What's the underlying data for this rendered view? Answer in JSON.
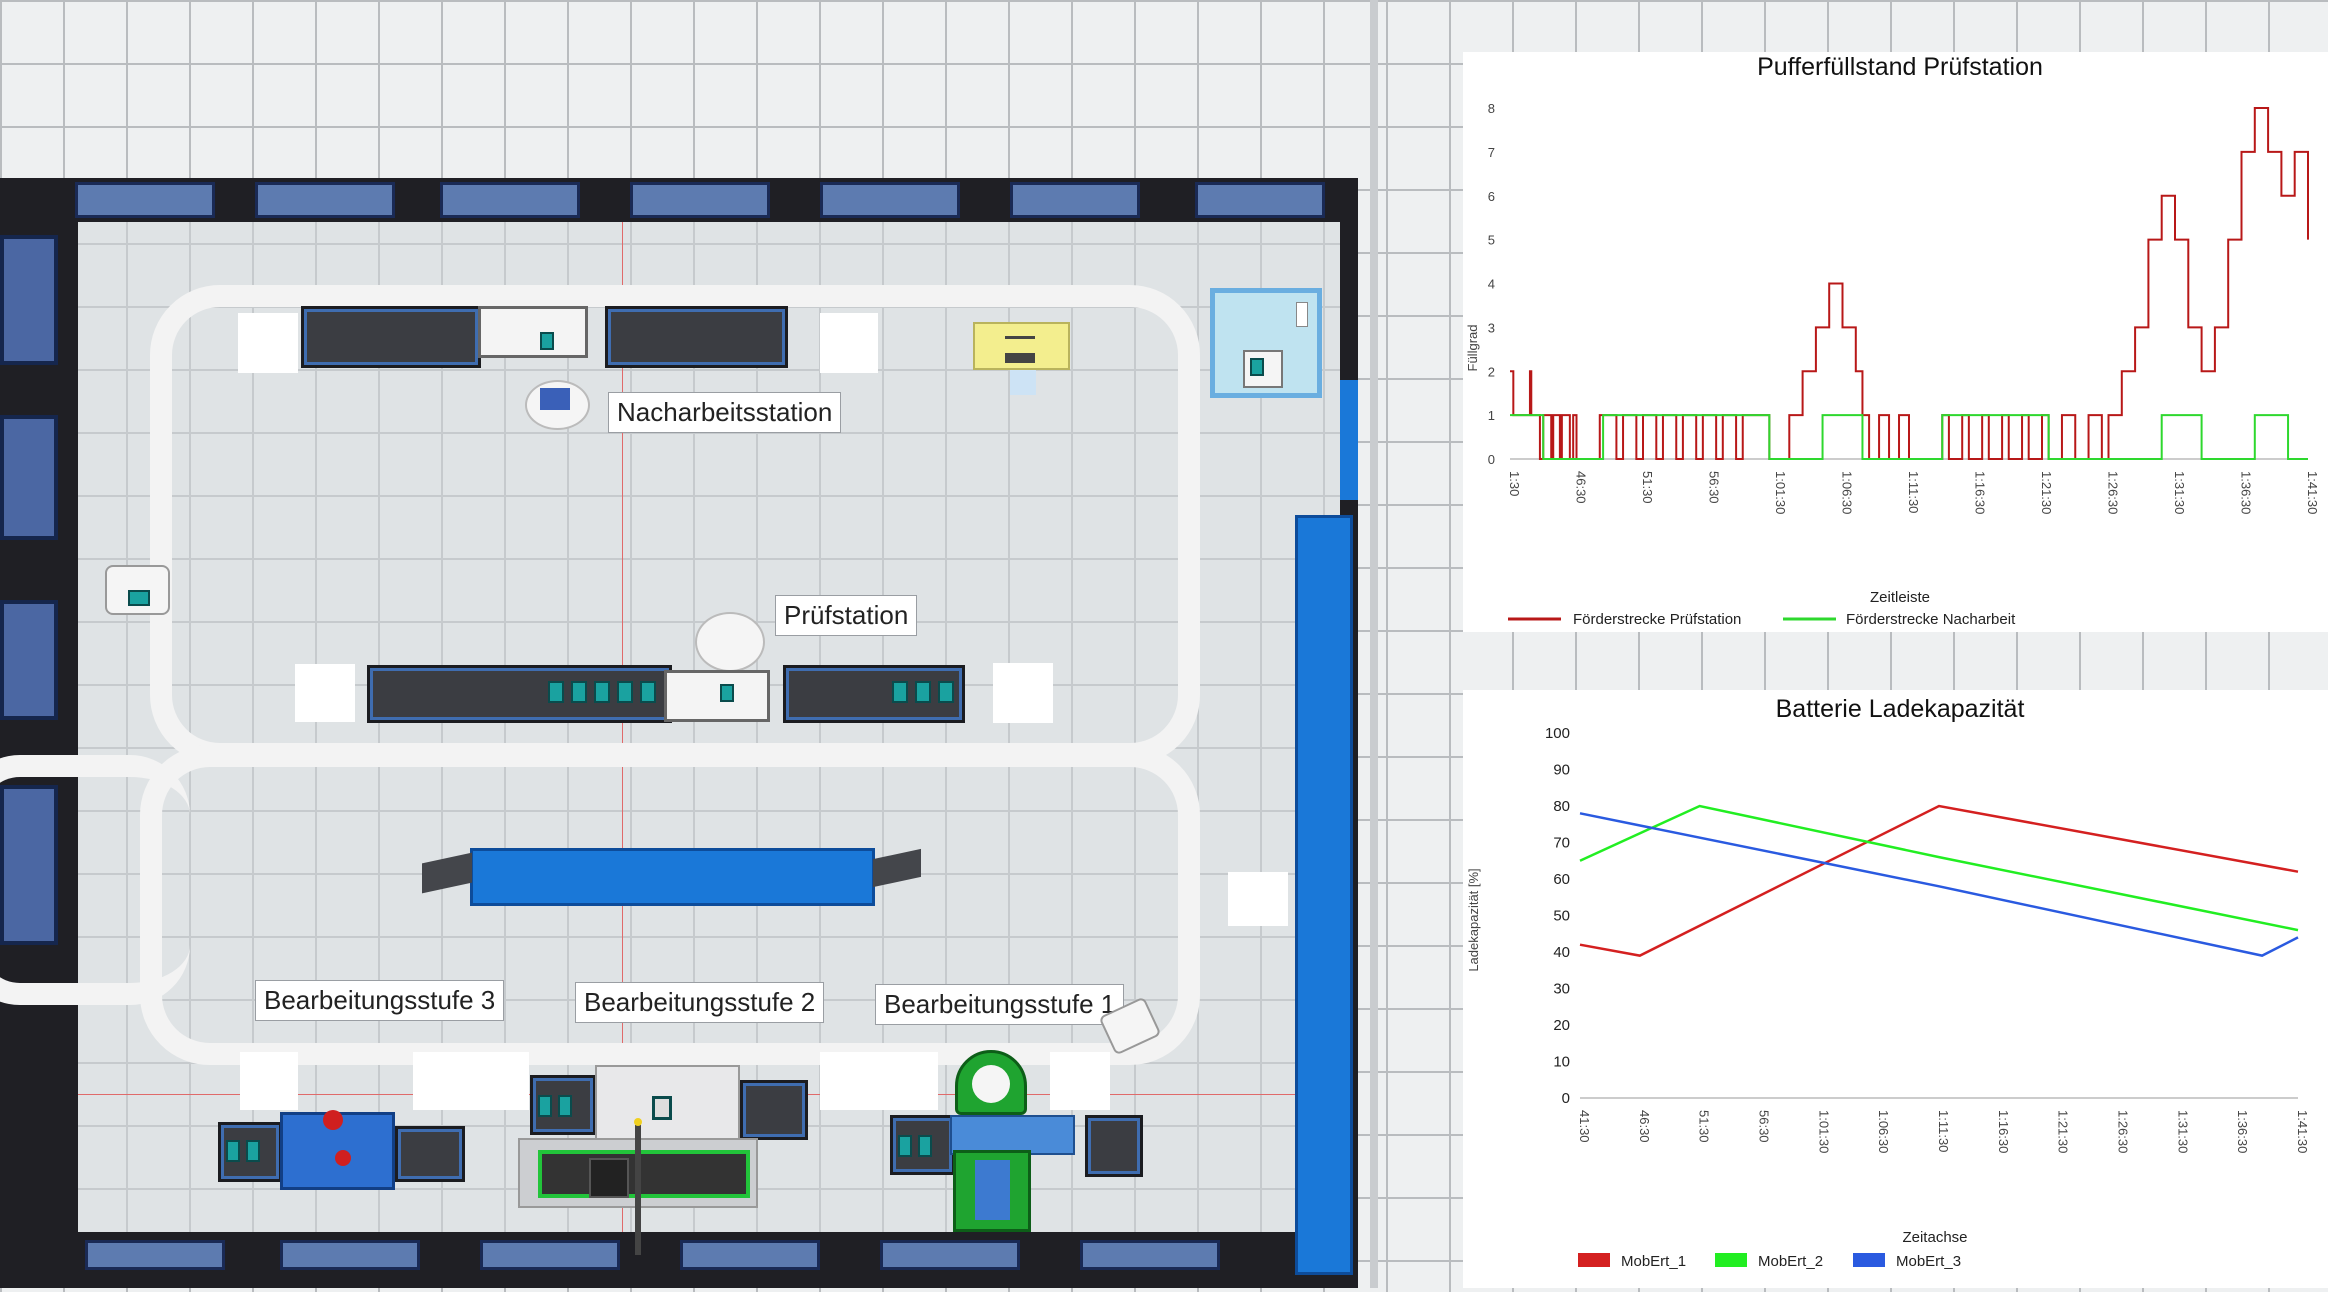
{
  "scene": {
    "stations": {
      "rework": "Nacharbeitsstation",
      "inspection": "Prüfstation",
      "stage3": "Bearbeitungsstufe 3",
      "stage2": "Bearbeitungsstufe 2",
      "stage1": "Bearbeitungsstufe 1"
    }
  },
  "colors": {
    "wall": "#1f1f24",
    "conveyor_blue": "#1a78d8",
    "teal": "#1aa2a0",
    "series_red": "#d42020",
    "series_green": "#22ee22",
    "series_blue": "#2a5ae0",
    "buffer_red": "#b81818",
    "buffer_green": "#2ed82e"
  },
  "charts": {
    "buffer": {
      "title": "Pufferfüllstand Prüfstation",
      "ylabel": "Füllgrad",
      "xlabel": "Zeitleiste",
      "legend": [
        "Förderstrecke Prüfstation",
        "Förderstrecke Nacharbeit"
      ]
    },
    "battery": {
      "title": "Batterie Ladekapazität",
      "ylabel": "Ladekapazität [%]",
      "xlabel": "Zeitachse",
      "legend": [
        "MobErt_1",
        "MobErt_2",
        "MobErt_3"
      ]
    }
  },
  "chart_data": [
    {
      "type": "line",
      "title": "Pufferfüllstand Prüfstation",
      "xlabel": "Zeitleiste",
      "ylabel": "Füllgrad",
      "ylim": [
        0,
        8
      ],
      "yticks": [
        0,
        1,
        2,
        3,
        4,
        5,
        6,
        7,
        8
      ],
      "xtick_labels": [
        "1:30",
        "46:30",
        "51:30",
        "56:30",
        "1:01:30",
        "1:06:30",
        "1:11:30",
        "1:16:30",
        "1:21:30",
        "1:26:30",
        "1:31:30",
        "1:36:30",
        "1:41:30"
      ],
      "xlim": [
        0,
        12
      ],
      "grid": false,
      "legend_position": "bottom",
      "series": [
        {
          "name": "Förderstrecke Prüfstation",
          "x": [
            0,
            0.05,
            0.3,
            0.32,
            0.45,
            0.5,
            0.62,
            0.65,
            0.75,
            0.78,
            0.9,
            0.95,
            1.0,
            1.05,
            1.3,
            1.35,
            1.6,
            1.7,
            1.9,
            2.0,
            2.2,
            2.3,
            2.5,
            2.6,
            2.8,
            2.9,
            3.1,
            3.2,
            3.4,
            3.5,
            3.9,
            4.2,
            4.4,
            4.6,
            4.8,
            5.0,
            5.2,
            5.3,
            5.4,
            5.55,
            5.7,
            5.85,
            6.0,
            6.5,
            6.6,
            6.8,
            6.9,
            7.1,
            7.2,
            7.4,
            7.5,
            7.7,
            7.8,
            8.0,
            8.1,
            8.3,
            8.5,
            8.7,
            8.9,
            9.0,
            9.2,
            9.4,
            9.6,
            9.8,
            10.0,
            10.2,
            10.4,
            10.6,
            10.8,
            11.0,
            11.2,
            11.4,
            11.6,
            11.8,
            12.0
          ],
          "y": [
            2,
            1,
            2,
            1,
            0,
            1,
            0,
            1,
            0,
            1,
            0,
            1,
            0,
            0,
            0,
            1,
            0,
            1,
            0,
            1,
            0,
            1,
            0,
            1,
            0,
            1,
            0,
            1,
            0,
            1,
            0,
            1,
            2,
            3,
            4,
            3,
            2,
            1,
            0,
            1,
            0,
            1,
            0,
            1,
            0,
            1,
            0,
            1,
            0,
            1,
            0,
            1,
            0,
            1,
            0,
            1,
            0,
            1,
            0,
            1,
            2,
            3,
            5,
            6,
            5,
            3,
            2,
            3,
            5,
            7,
            8,
            7,
            6,
            7,
            5
          ]
        },
        {
          "name": "Förderstrecke Nacharbeit",
          "x": [
            0,
            0.3,
            0.3,
            0.5,
            0.5,
            1.4,
            1.4,
            3.9,
            3.9,
            4.7,
            4.7,
            5.3,
            5.3,
            6.5,
            6.5,
            8.1,
            8.1,
            9.8,
            9.8,
            10.4,
            10.4,
            11.2,
            11.2,
            11.7,
            11.7,
            12.0
          ],
          "y": [
            1,
            1,
            1,
            1,
            0,
            0,
            1,
            1,
            0,
            0,
            1,
            1,
            0,
            0,
            1,
            1,
            0,
            0,
            1,
            1,
            0,
            0,
            1,
            1,
            0,
            0
          ]
        }
      ]
    },
    {
      "type": "line",
      "title": "Batterie Ladekapazität",
      "xlabel": "Zeitachse",
      "ylabel": "Ladekapazität [%]",
      "ylim": [
        0,
        100
      ],
      "yticks": [
        0,
        10,
        20,
        30,
        40,
        50,
        60,
        70,
        80,
        90,
        100
      ],
      "xtick_labels": [
        "41:30",
        "46:30",
        "51:30",
        "56:30",
        "1:01:30",
        "1:06:30",
        "1:11:30",
        "1:16:30",
        "1:21:30",
        "1:26:30",
        "1:31:30",
        "1:36:30",
        "1:41:30"
      ],
      "xlim": [
        0,
        12
      ],
      "grid": false,
      "legend_position": "bottom",
      "series": [
        {
          "name": "MobErt_1",
          "x": [
            0,
            1,
            6,
            12
          ],
          "y": [
            42,
            39,
            80,
            62
          ]
        },
        {
          "name": "MobErt_2",
          "x": [
            0,
            2,
            6,
            12
          ],
          "y": [
            65,
            80,
            66,
            46
          ]
        },
        {
          "name": "MobErt_3",
          "x": [
            0,
            6,
            11.4,
            12
          ],
          "y": [
            78,
            58,
            39,
            44
          ]
        }
      ]
    }
  ]
}
